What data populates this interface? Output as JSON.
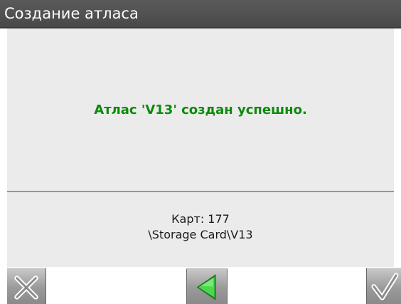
{
  "window": {
    "title": "Создание атласа"
  },
  "main": {
    "message": "Атлас 'V13' создан успешно.",
    "maps_count": "Карт: 177",
    "path": "\\Storage Card\\V13"
  },
  "toolbar": {
    "buttons": [
      {
        "icon": "close-icon"
      },
      {
        "icon": "back-arrow-icon"
      },
      {
        "icon": "checkmark-icon"
      }
    ]
  },
  "colors": {
    "titlebar": "#505050",
    "content_bg": "#ebebeb",
    "message_text": "#0b8a0b",
    "separator": "#7f9cb7",
    "button_bg": "#9a9a9a",
    "arrow_green": "#4cd84c"
  }
}
